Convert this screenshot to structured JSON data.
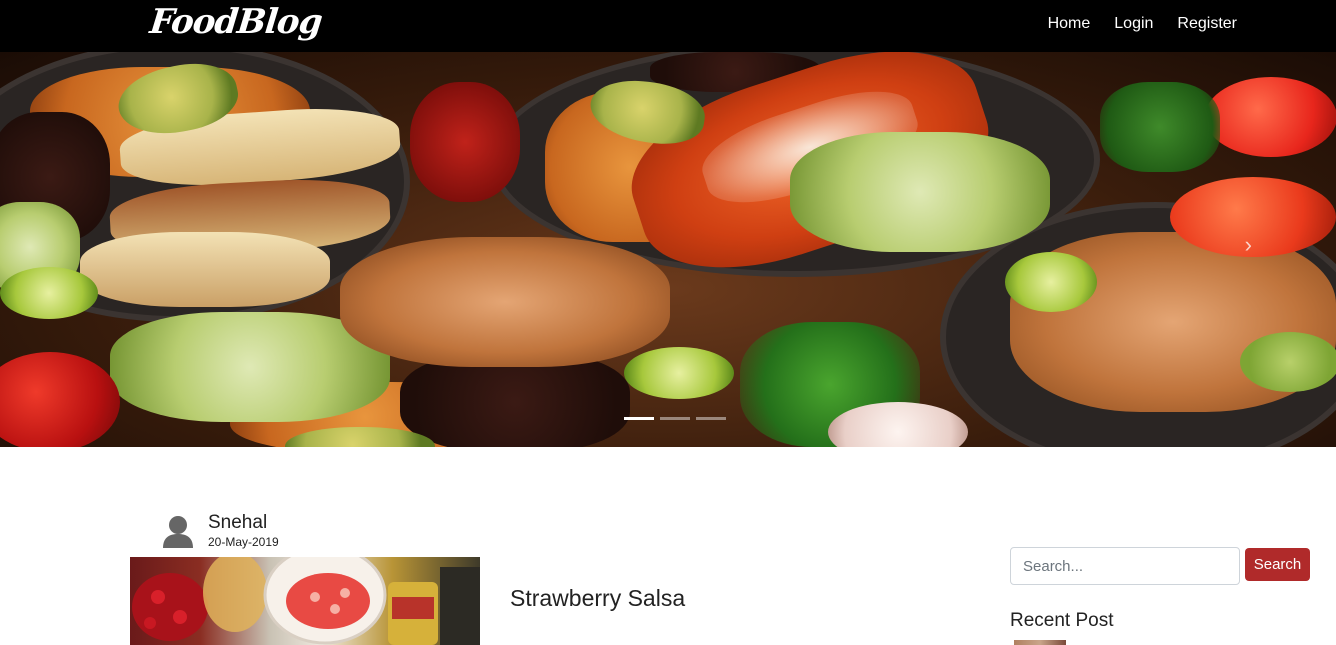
{
  "navbar": {
    "brand": "FoodBlog",
    "links": [
      "Home",
      "Login",
      "Register"
    ]
  },
  "hero": {
    "slide_count": 3,
    "active_slide": 1,
    "image_icon": "food-platter-image",
    "next_icon": "chevron-right-icon"
  },
  "post": {
    "author": "Snehal",
    "date": "20-May-2019",
    "title": "Strawberry Salsa",
    "author_icon": "user-icon"
  },
  "sidebar": {
    "search_placeholder": "Search...",
    "search_button": "Search",
    "recent_heading": "Recent Post"
  },
  "colors": {
    "navbar_bg": "#000000",
    "search_button_bg": "#b02a2a",
    "text": "#222222"
  }
}
